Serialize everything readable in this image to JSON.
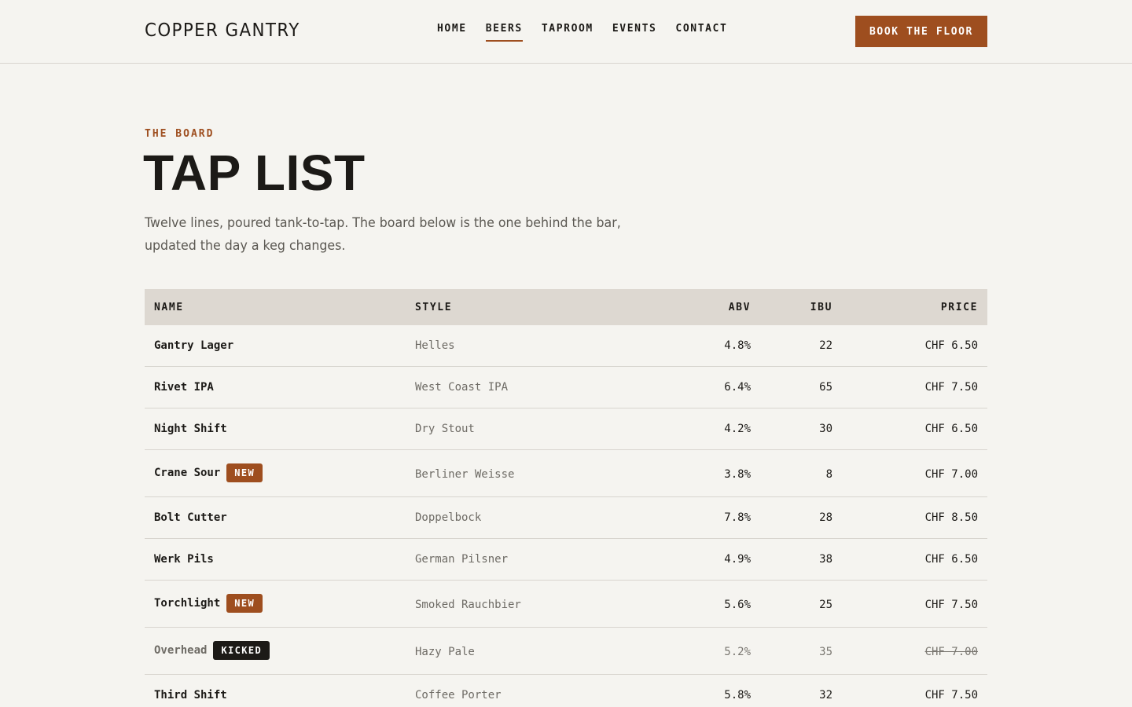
{
  "header": {
    "logo": "COPPER GANTRY",
    "nav": [
      {
        "label": "HOME",
        "active": false
      },
      {
        "label": "BEERS",
        "active": true
      },
      {
        "label": "TAPROOM",
        "active": false
      },
      {
        "label": "EVENTS",
        "active": false
      },
      {
        "label": "CONTACT",
        "active": false
      }
    ],
    "cta_label": "BOOK THE FLOOR"
  },
  "hero": {
    "eyebrow": "THE BOARD",
    "title": "TAP LIST",
    "intro": "Twelve lines, poured tank-to-tap. The board below is the one behind the bar, updated the day a keg changes."
  },
  "table": {
    "columns": [
      "NAME",
      "STYLE",
      "ABV",
      "IBU",
      "PRICE"
    ],
    "rows": [
      {
        "name": "Gantry Lager",
        "badge": "",
        "style": "Helles",
        "abv": "4.8%",
        "ibu": "22",
        "price": "CHF 6.50",
        "status": "on"
      },
      {
        "name": "Rivet IPA",
        "badge": "",
        "style": "West Coast IPA",
        "abv": "6.4%",
        "ibu": "65",
        "price": "CHF 7.50",
        "status": "on"
      },
      {
        "name": "Night Shift",
        "badge": "",
        "style": "Dry Stout",
        "abv": "4.2%",
        "ibu": "30",
        "price": "CHF 6.50",
        "status": "on"
      },
      {
        "name": "Crane Sour",
        "badge": "NEW",
        "style": "Berliner Weisse",
        "abv": "3.8%",
        "ibu": "8",
        "price": "CHF 7.00",
        "status": "new"
      },
      {
        "name": "Bolt Cutter",
        "badge": "",
        "style": "Doppelbock",
        "abv": "7.8%",
        "ibu": "28",
        "price": "CHF 8.50",
        "status": "on"
      },
      {
        "name": "Werk Pils",
        "badge": "",
        "style": "German Pilsner",
        "abv": "4.9%",
        "ibu": "38",
        "price": "CHF 6.50",
        "status": "on"
      },
      {
        "name": "Torchlight",
        "badge": "NEW",
        "style": "Smoked Rauchbier",
        "abv": "5.6%",
        "ibu": "25",
        "price": "CHF 7.50",
        "status": "new"
      },
      {
        "name": "Overhead",
        "badge": "KICKED",
        "style": "Hazy Pale",
        "abv": "5.2%",
        "ibu": "35",
        "price": "CHF 7.00",
        "status": "kicked"
      },
      {
        "name": "Third Shift",
        "badge": "",
        "style": "Coffee Porter",
        "abv": "5.8%",
        "ibu": "32",
        "price": "CHF 7.50",
        "status": "on"
      }
    ]
  },
  "colors": {
    "accent": "#9e4e1f",
    "background": "#f5f4f0",
    "header_row": "#ddd8d1",
    "ink": "#1c1a17",
    "muted": "#6e6b65"
  }
}
